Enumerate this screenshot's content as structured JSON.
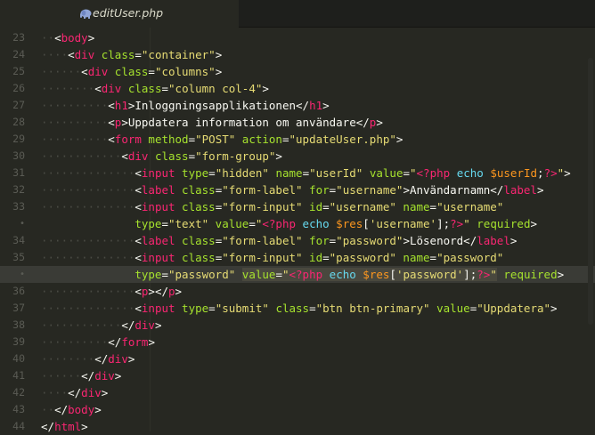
{
  "tab": {
    "filename": "editUser.php",
    "icon": "elephant-icon"
  },
  "lines": [
    {
      "n": "23",
      "i": 1,
      "code": [
        [
          "p",
          "<"
        ],
        [
          "t",
          "body"
        ],
        [
          "p",
          ">"
        ]
      ]
    },
    {
      "n": "24",
      "i": 2,
      "code": [
        [
          "p",
          "<"
        ],
        [
          "t",
          "div"
        ],
        [
          "a",
          " class"
        ],
        [
          "p",
          "="
        ],
        [
          "s",
          "\"container\""
        ],
        [
          "p",
          ">"
        ]
      ]
    },
    {
      "n": "25",
      "i": 3,
      "code": [
        [
          "p",
          "<"
        ],
        [
          "t",
          "div"
        ],
        [
          "a",
          " class"
        ],
        [
          "p",
          "="
        ],
        [
          "s",
          "\"columns\""
        ],
        [
          "p",
          ">"
        ]
      ]
    },
    {
      "n": "26",
      "i": 4,
      "code": [
        [
          "p",
          "<"
        ],
        [
          "t",
          "div"
        ],
        [
          "a",
          " class"
        ],
        [
          "p",
          "="
        ],
        [
          "s",
          "\"column col-4\""
        ],
        [
          "p",
          ">"
        ]
      ]
    },
    {
      "n": "27",
      "i": 5,
      "code": [
        [
          "p",
          "<"
        ],
        [
          "t",
          "h1"
        ],
        [
          "p",
          ">Inloggningsapplikationen</"
        ],
        [
          "t",
          "h1"
        ],
        [
          "p",
          ">"
        ]
      ]
    },
    {
      "n": "28",
      "i": 5,
      "code": [
        [
          "p",
          "<"
        ],
        [
          "t",
          "p"
        ],
        [
          "p",
          ">Uppdatera information om användare</"
        ],
        [
          "t",
          "p"
        ],
        [
          "p",
          ">"
        ]
      ]
    },
    {
      "n": "29",
      "i": 5,
      "code": [
        [
          "p",
          "<"
        ],
        [
          "t",
          "form"
        ],
        [
          "a",
          " method"
        ],
        [
          "p",
          "="
        ],
        [
          "s",
          "\"POST\""
        ],
        [
          "a",
          " action"
        ],
        [
          "p",
          "="
        ],
        [
          "s",
          "\"updateUser.php\""
        ],
        [
          "p",
          ">"
        ]
      ]
    },
    {
      "n": "30",
      "i": 6,
      "code": [
        [
          "p",
          "<"
        ],
        [
          "t",
          "div"
        ],
        [
          "a",
          " class"
        ],
        [
          "p",
          "="
        ],
        [
          "s",
          "\"form-group\""
        ],
        [
          "p",
          ">"
        ]
      ]
    },
    {
      "n": "31",
      "i": 7,
      "code": [
        [
          "p",
          "<"
        ],
        [
          "t",
          "input"
        ],
        [
          "a",
          " type"
        ],
        [
          "p",
          "="
        ],
        [
          "s",
          "\"hidden\""
        ],
        [
          "a",
          " name"
        ],
        [
          "p",
          "="
        ],
        [
          "s",
          "\"userId\""
        ],
        [
          "a",
          " value"
        ],
        [
          "p",
          "="
        ],
        [
          "s",
          "\""
        ],
        [
          "t",
          "<?php"
        ],
        [
          "k",
          " echo"
        ],
        [
          "v",
          " $userId"
        ],
        [
          "p",
          ";"
        ],
        [
          "t",
          "?>"
        ],
        [
          "s",
          "\""
        ],
        [
          "p",
          ">"
        ]
      ]
    },
    {
      "n": "32",
      "i": 7,
      "code": [
        [
          "p",
          "<"
        ],
        [
          "t",
          "label"
        ],
        [
          "a",
          " class"
        ],
        [
          "p",
          "="
        ],
        [
          "s",
          "\"form-label\""
        ],
        [
          "a",
          " for"
        ],
        [
          "p",
          "="
        ],
        [
          "s",
          "\"username\""
        ],
        [
          "p",
          ">Användarnamn</"
        ],
        [
          "t",
          "label"
        ],
        [
          "p",
          ">"
        ]
      ]
    },
    {
      "n": "33",
      "i": 7,
      "code": [
        [
          "p",
          "<"
        ],
        [
          "t",
          "input"
        ],
        [
          "a",
          " class"
        ],
        [
          "p",
          "="
        ],
        [
          "s",
          "\"form-input\""
        ],
        [
          "a",
          " id"
        ],
        [
          "p",
          "="
        ],
        [
          "s",
          "\"username\""
        ],
        [
          "a",
          " name"
        ],
        [
          "p",
          "="
        ],
        [
          "s",
          "\"username\""
        ]
      ]
    },
    {
      "n": "•",
      "i": 7,
      "wrap": true,
      "code": [
        [
          "a",
          "type"
        ],
        [
          "p",
          "="
        ],
        [
          "s",
          "\"text\""
        ],
        [
          "a",
          " value"
        ],
        [
          "p",
          "="
        ],
        [
          "s",
          "\""
        ],
        [
          "t",
          "<?php"
        ],
        [
          "k",
          " echo"
        ],
        [
          "v",
          " $res"
        ],
        [
          "p",
          "["
        ],
        [
          "s",
          "'username'"
        ],
        [
          "p",
          "];"
        ],
        [
          "t",
          "?>"
        ],
        [
          "s",
          "\""
        ],
        [
          "a",
          " required"
        ],
        [
          "p",
          ">"
        ]
      ]
    },
    {
      "n": "34",
      "i": 7,
      "code": [
        [
          "p",
          "<"
        ],
        [
          "t",
          "label"
        ],
        [
          "a",
          " class"
        ],
        [
          "p",
          "="
        ],
        [
          "s",
          "\"form-label\""
        ],
        [
          "a",
          " for"
        ],
        [
          "p",
          "="
        ],
        [
          "s",
          "\"password\""
        ],
        [
          "p",
          ">Lösenord</"
        ],
        [
          "t",
          "label"
        ],
        [
          "p",
          ">"
        ]
      ]
    },
    {
      "n": "35",
      "i": 7,
      "code": [
        [
          "p",
          "<"
        ],
        [
          "t",
          "input"
        ],
        [
          "a",
          " class"
        ],
        [
          "p",
          "="
        ],
        [
          "s",
          "\"form-input\""
        ],
        [
          "a",
          " id"
        ],
        [
          "p",
          "="
        ],
        [
          "s",
          "\"password\""
        ],
        [
          "a",
          " name"
        ],
        [
          "p",
          "="
        ],
        [
          "s",
          "\"password\""
        ]
      ]
    },
    {
      "n": "•",
      "i": 7,
      "wrap": true,
      "hl": true,
      "code": [
        [
          "a",
          "type"
        ],
        [
          "p",
          "="
        ],
        [
          "s",
          "\"password\" "
        ],
        [
          "a",
          "value",
          "sel"
        ],
        [
          "p",
          "=",
          "sel"
        ],
        [
          "s",
          "\"",
          "sel"
        ],
        [
          "t",
          "<?php",
          "sel"
        ],
        [
          "k",
          " echo",
          "sel"
        ],
        [
          "v",
          " $res",
          "sel"
        ],
        [
          "p",
          "[",
          "sel"
        ],
        [
          "s",
          "'password'",
          "sel"
        ],
        [
          "p",
          "];",
          "sel"
        ],
        [
          "t",
          "?>",
          "sel"
        ],
        [
          "s",
          "\"",
          "sel"
        ],
        [
          "a",
          " required"
        ],
        [
          "p",
          ">"
        ]
      ]
    },
    {
      "n": "36",
      "i": 7,
      "code": [
        [
          "p",
          "<"
        ],
        [
          "t",
          "p"
        ],
        [
          "p",
          "></"
        ],
        [
          "t",
          "p"
        ],
        [
          "p",
          ">"
        ]
      ]
    },
    {
      "n": "37",
      "i": 7,
      "code": [
        [
          "p",
          "<"
        ],
        [
          "t",
          "input"
        ],
        [
          "a",
          " type"
        ],
        [
          "p",
          "="
        ],
        [
          "s",
          "\"submit\""
        ],
        [
          "a",
          " class"
        ],
        [
          "p",
          "="
        ],
        [
          "s",
          "\"btn btn-primary\""
        ],
        [
          "a",
          " value"
        ],
        [
          "p",
          "="
        ],
        [
          "s",
          "\"Uppdatera\""
        ],
        [
          "p",
          ">"
        ]
      ]
    },
    {
      "n": "38",
      "i": 6,
      "code": [
        [
          "p",
          "</"
        ],
        [
          "t",
          "div"
        ],
        [
          "p",
          ">"
        ]
      ]
    },
    {
      "n": "39",
      "i": 5,
      "code": [
        [
          "p",
          "</"
        ],
        [
          "t",
          "form"
        ],
        [
          "p",
          ">"
        ]
      ]
    },
    {
      "n": "40",
      "i": 4,
      "code": [
        [
          "p",
          "</"
        ],
        [
          "t",
          "div"
        ],
        [
          "p",
          ">"
        ]
      ]
    },
    {
      "n": "41",
      "i": 3,
      "code": [
        [
          "p",
          "</"
        ],
        [
          "t",
          "div"
        ],
        [
          "p",
          ">"
        ]
      ]
    },
    {
      "n": "42",
      "i": 2,
      "code": [
        [
          "p",
          "</"
        ],
        [
          "t",
          "div"
        ],
        [
          "p",
          ">"
        ]
      ]
    },
    {
      "n": "43",
      "i": 1,
      "code": [
        [
          "p",
          "</"
        ],
        [
          "t",
          "body"
        ],
        [
          "p",
          ">"
        ]
      ]
    },
    {
      "n": "44",
      "i": 0,
      "code": [
        [
          "p",
          "</"
        ],
        [
          "t",
          "html"
        ],
        [
          "p",
          ">"
        ]
      ]
    }
  ]
}
